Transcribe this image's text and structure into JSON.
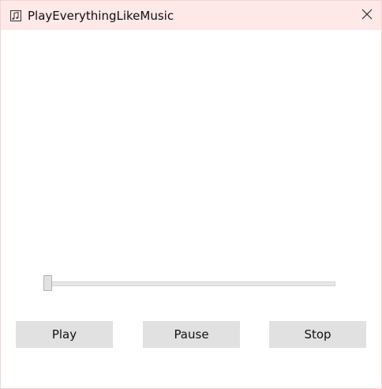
{
  "window": {
    "title": "PlayEverythingLikeMusic",
    "app_icon": "music-note-icon",
    "close_icon": "close-icon"
  },
  "player": {
    "position_fraction": 0.0
  },
  "buttons": {
    "play_label": "Play",
    "pause_label": "Pause",
    "stop_label": "Stop"
  },
  "colors": {
    "titlebar_bg": "#ffe8e8",
    "window_border": "#f6d2d2",
    "button_bg": "#e1e1e1",
    "track_bg": "#e7e7e7"
  }
}
